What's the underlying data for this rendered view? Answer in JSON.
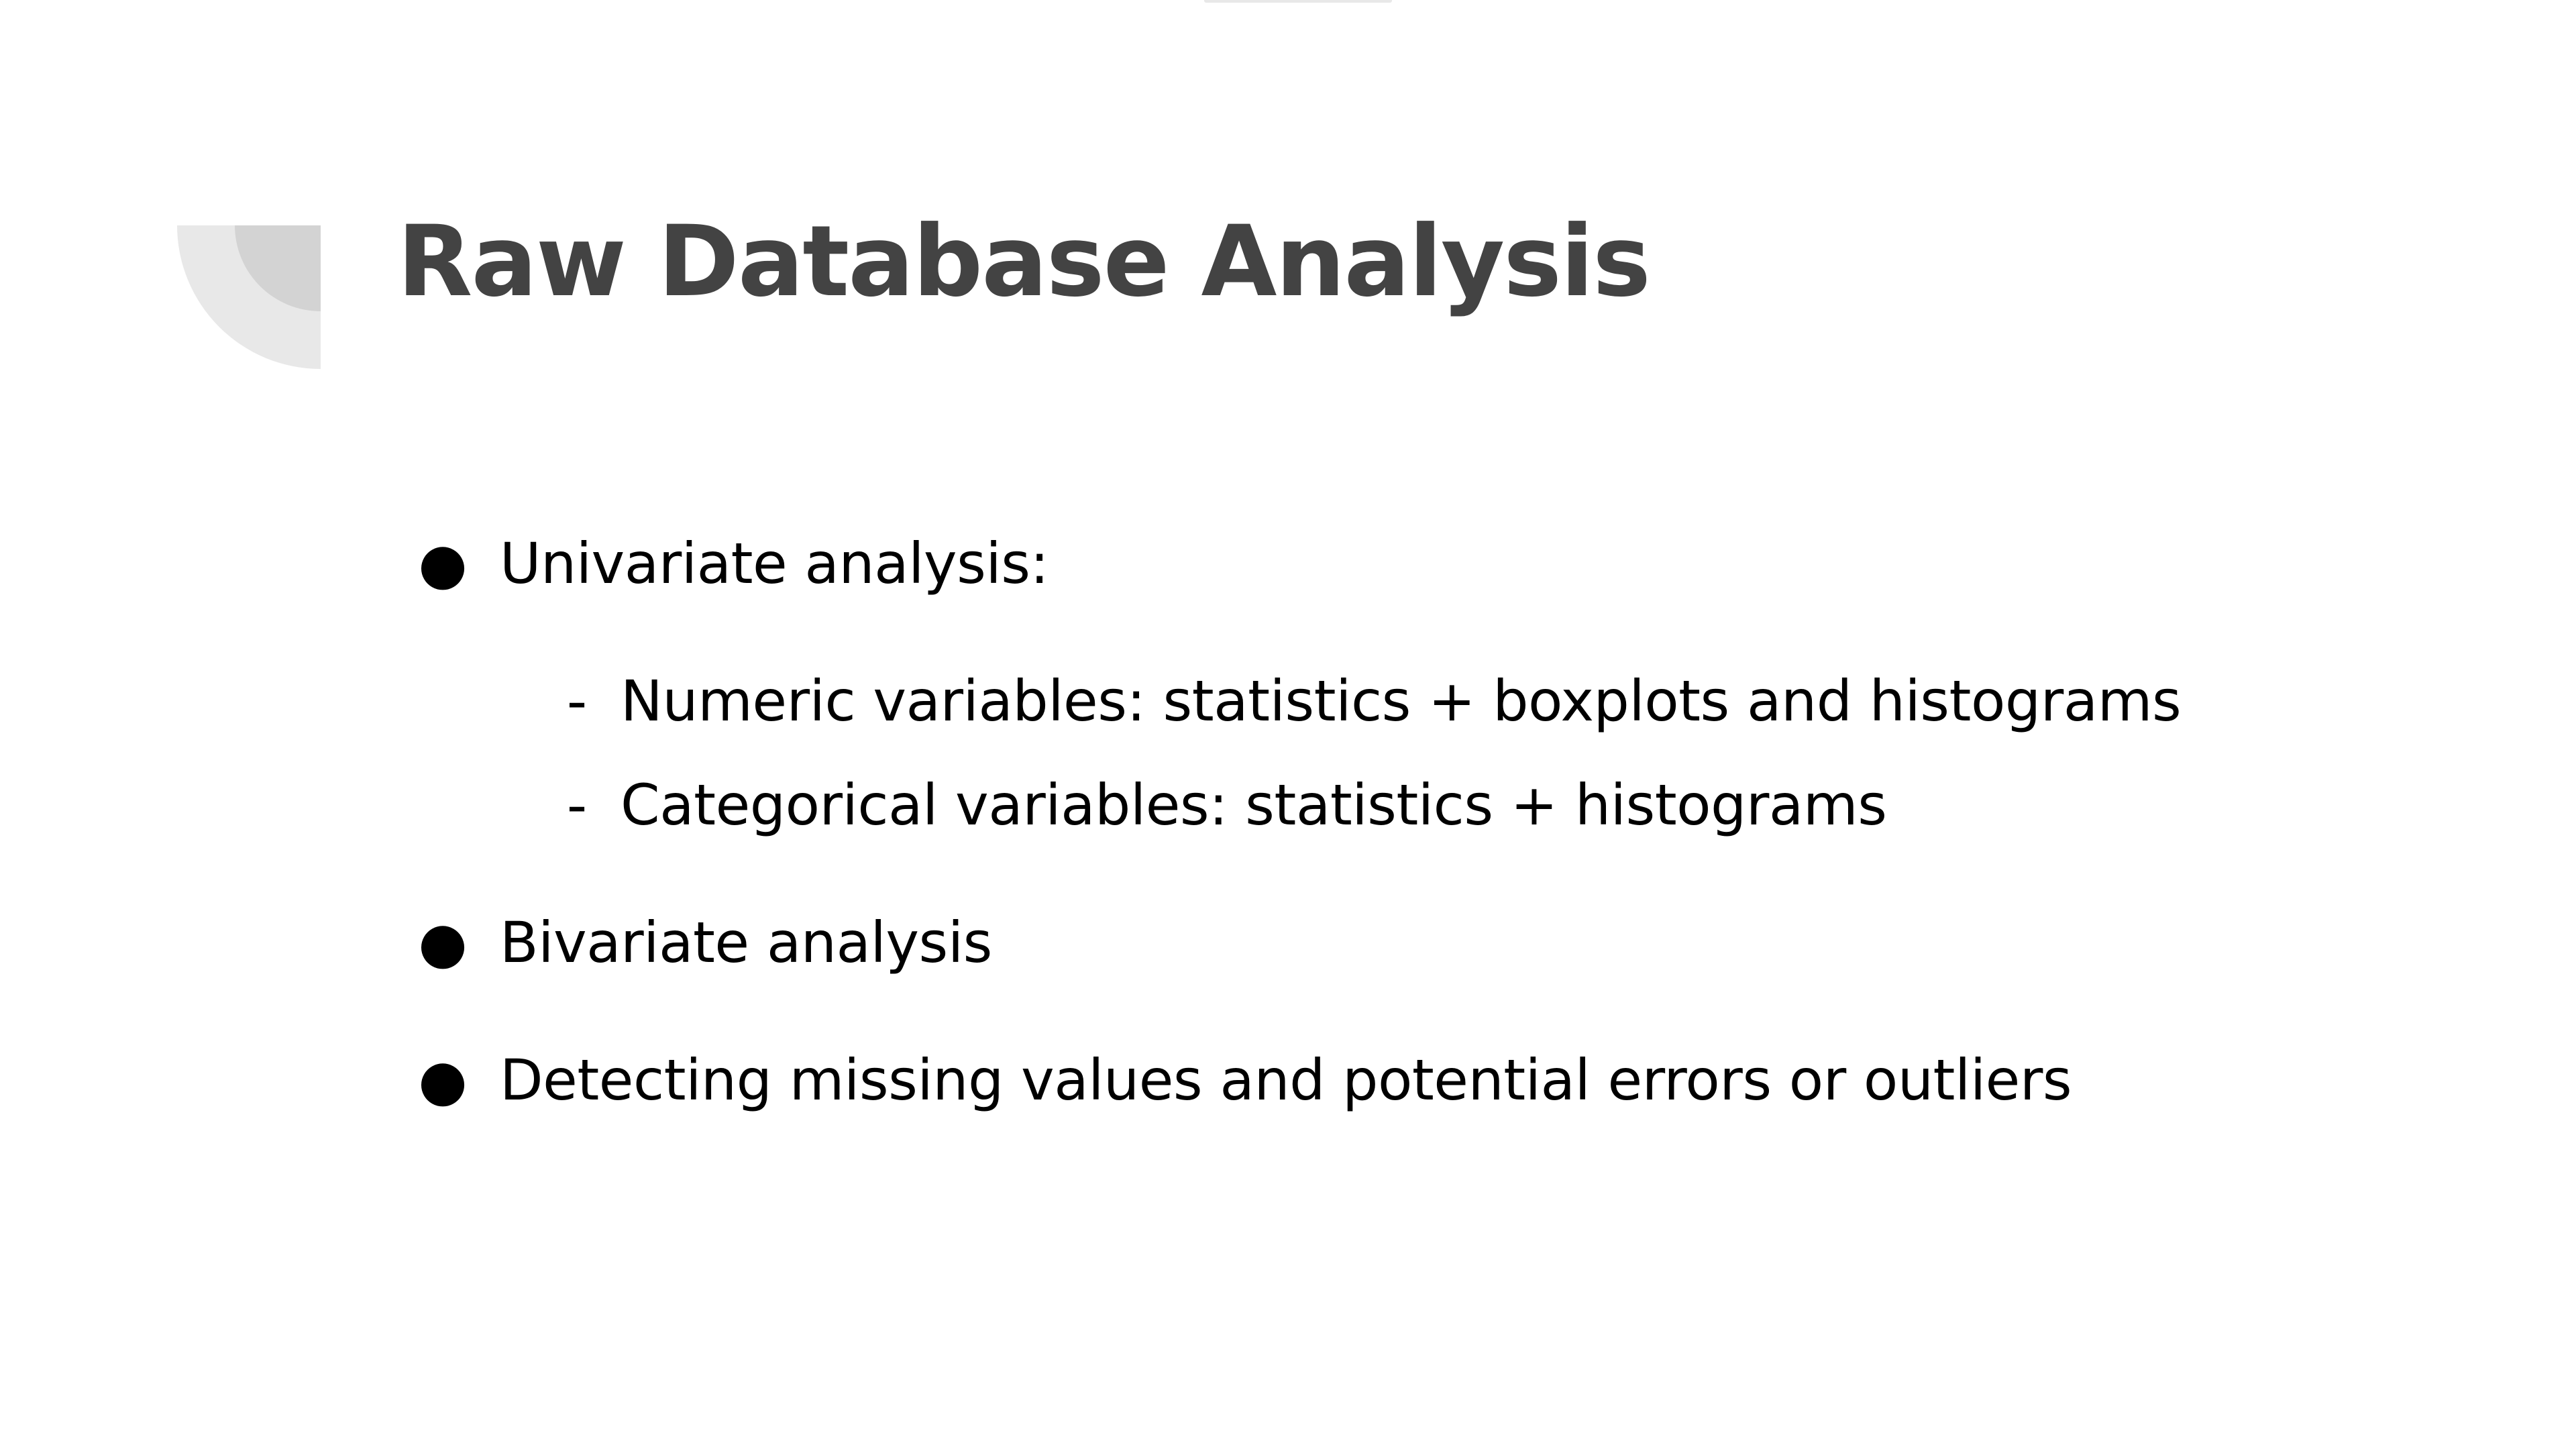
{
  "slide": {
    "title": "Raw Database Analysis",
    "colors": {
      "title": "#434343",
      "body_text": "#000000",
      "deco_outer": "#e8e8e8",
      "deco_inner": "#d3d3d3"
    },
    "bullets": [
      {
        "marker": "●",
        "text": "Univariate analysis:",
        "subitems": [
          {
            "marker": "-",
            "text": "Numeric variables: statistics + boxplots and histograms"
          },
          {
            "marker": "-",
            "text": "Categorical variables: statistics + histograms"
          }
        ]
      },
      {
        "marker": "●",
        "text": "Bivariate analysis",
        "subitems": []
      },
      {
        "marker": "●",
        "text": "Detecting missing values and potential errors or outliers",
        "subitems": []
      }
    ]
  }
}
